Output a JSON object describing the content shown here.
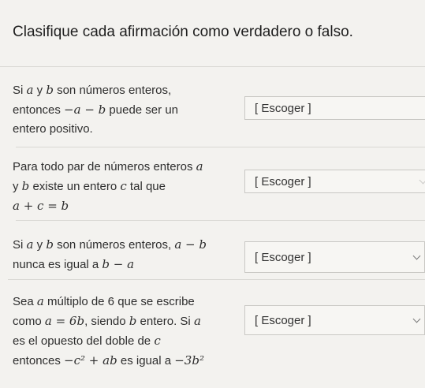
{
  "page": {
    "title": "Clasifique cada afirmación como verdadero o falso."
  },
  "statements": [
    {
      "lines": [
        [
          "Si ",
          {
            "m": "a"
          },
          " y ",
          {
            "m": "b"
          },
          " son números enteros,"
        ],
        [
          "entonces ",
          {
            "m": "−a − b"
          },
          " puede ser un"
        ],
        [
          "entero positivo."
        ]
      ],
      "select_label": "[ Escoger ]"
    },
    {
      "lines": [
        [
          "Para todo par de números enteros ",
          {
            "m": "a"
          }
        ],
        [
          "y ",
          {
            "m": "b"
          },
          " existe un entero ",
          {
            "m": "c"
          },
          " tal que"
        ],
        [
          {
            "m": "a + c = b"
          }
        ]
      ],
      "select_label": "[ Escoger ]"
    },
    {
      "lines": [
        [
          "Si ",
          {
            "m": "a"
          },
          " y ",
          {
            "m": "b"
          },
          " son números enteros, ",
          {
            "m": "a − b"
          }
        ],
        [
          "nunca es igual a ",
          {
            "m": "b − a"
          }
        ]
      ],
      "select_label": "[ Escoger ]"
    },
    {
      "lines": [
        [
          "Sea ",
          {
            "m": "a"
          },
          " múltiplo de 6 que se escribe"
        ],
        [
          "como ",
          {
            "m": "a = 6b"
          },
          ", siendo ",
          {
            "m": "b"
          },
          " entero. Si ",
          {
            "m": "a"
          }
        ],
        [
          "es el opuesto del doble de ",
          {
            "m": "c"
          }
        ],
        [
          "entonces ",
          {
            "m": "−c² + ab"
          },
          " es igual a ",
          {
            "m": "−3b²"
          }
        ]
      ],
      "select_label": "[ Escoger ]"
    }
  ]
}
